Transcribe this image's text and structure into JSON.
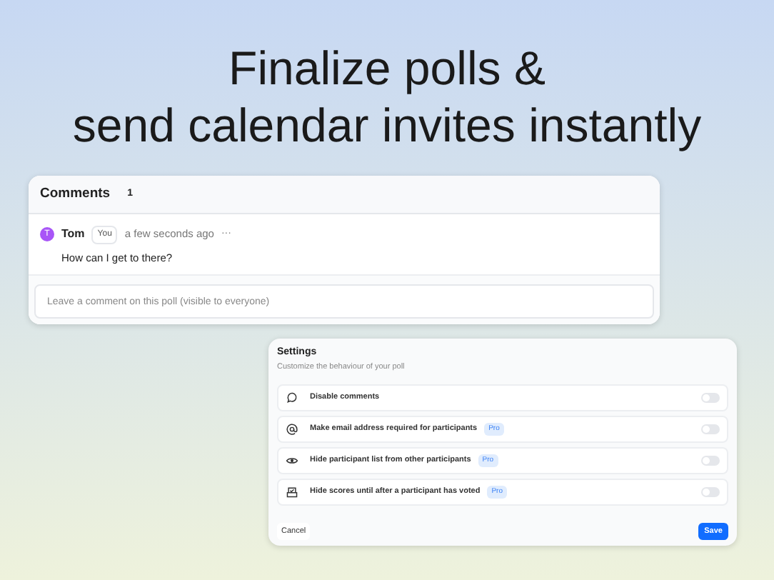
{
  "headline": [
    "Finalize polls &",
    "send calendar invites instantly"
  ],
  "comments": {
    "title": "Comments",
    "count": "1",
    "items": [
      {
        "avatar": "T",
        "color": "#a855f7",
        "author": "Tom",
        "tag": "You",
        "time": "a few seconds ago",
        "menu": "···",
        "text": "How can I get to there?"
      }
    ],
    "input": {
      "placeholder": "Leave a comment on this poll (visible to everyone)"
    }
  },
  "settings": {
    "title": "Settings",
    "subtitle": "Customize the behaviour of your poll",
    "options": [
      {
        "label": "Disable comments",
        "on": false
      },
      {
        "label": "Make email address required for participants",
        "badge": "Pro",
        "on": false
      },
      {
        "label": "Hide participant list from other participants",
        "badge": "Pro",
        "on": false
      },
      {
        "label": "Hide scores until after a participant has voted",
        "badge": "Pro",
        "on": false
      }
    ],
    "buttons": [
      {
        "label": "Cancel",
        "kind": "secondary"
      },
      {
        "label": "Save",
        "kind": "primary"
      }
    ]
  }
}
